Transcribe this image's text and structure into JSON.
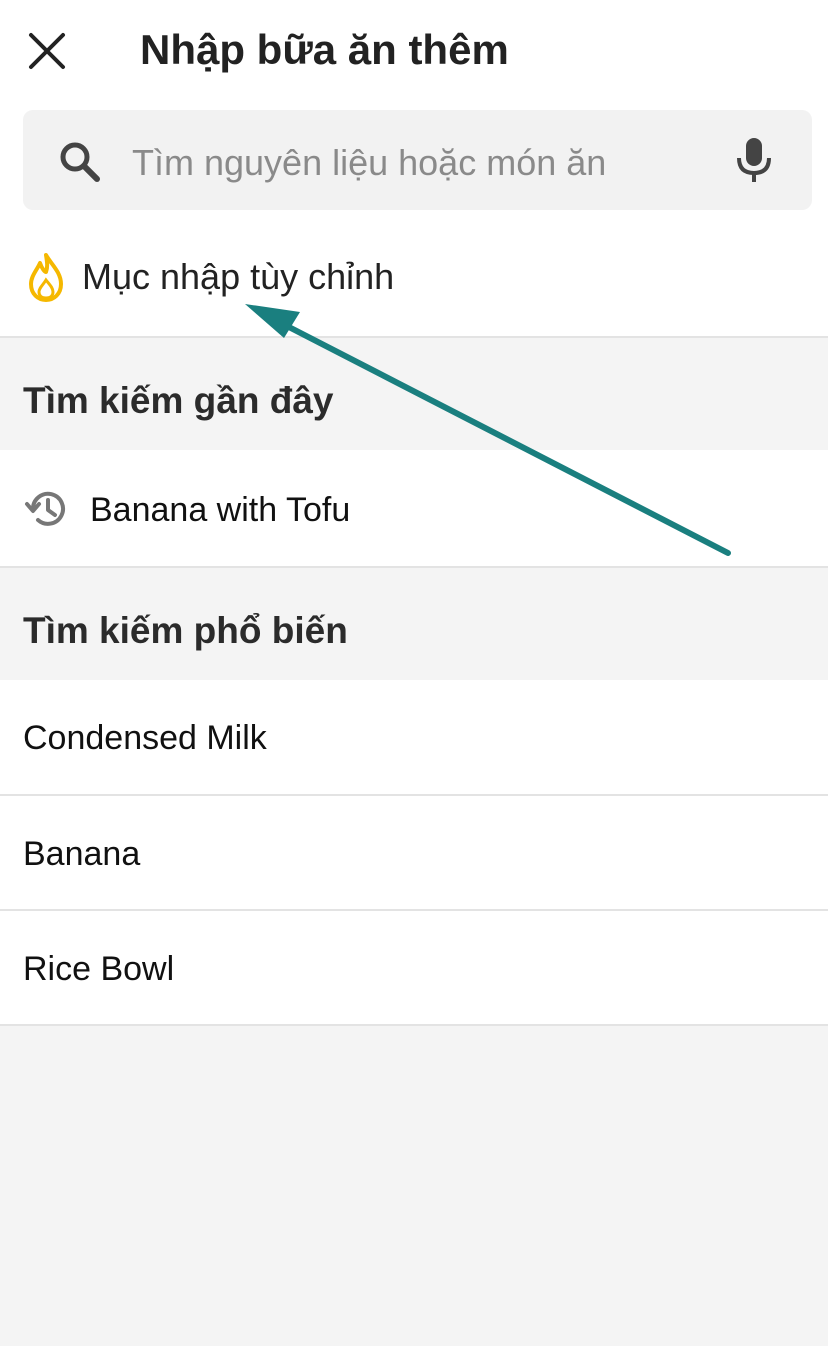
{
  "header": {
    "title": "Nhập bữa ăn thêm",
    "close_icon": "close-icon"
  },
  "search": {
    "placeholder": "Tìm nguyên liệu hoặc món ăn",
    "value": "",
    "search_icon": "search-icon",
    "mic_icon": "microphone-icon"
  },
  "custom_entry": {
    "label": "Mục nhập tùy chỉnh",
    "icon": "flame-icon",
    "icon_color": "#F5B800"
  },
  "recent": {
    "title": "Tìm kiếm gần đây",
    "items": [
      {
        "label": "Banana with Tofu",
        "icon": "history-icon"
      }
    ]
  },
  "popular": {
    "title": "Tìm kiếm phổ biến",
    "items": [
      {
        "label": "Condensed Milk"
      },
      {
        "label": "Banana"
      },
      {
        "label": "Rice Bowl"
      }
    ]
  },
  "annotation": {
    "arrow_color": "#1a7f7f"
  }
}
